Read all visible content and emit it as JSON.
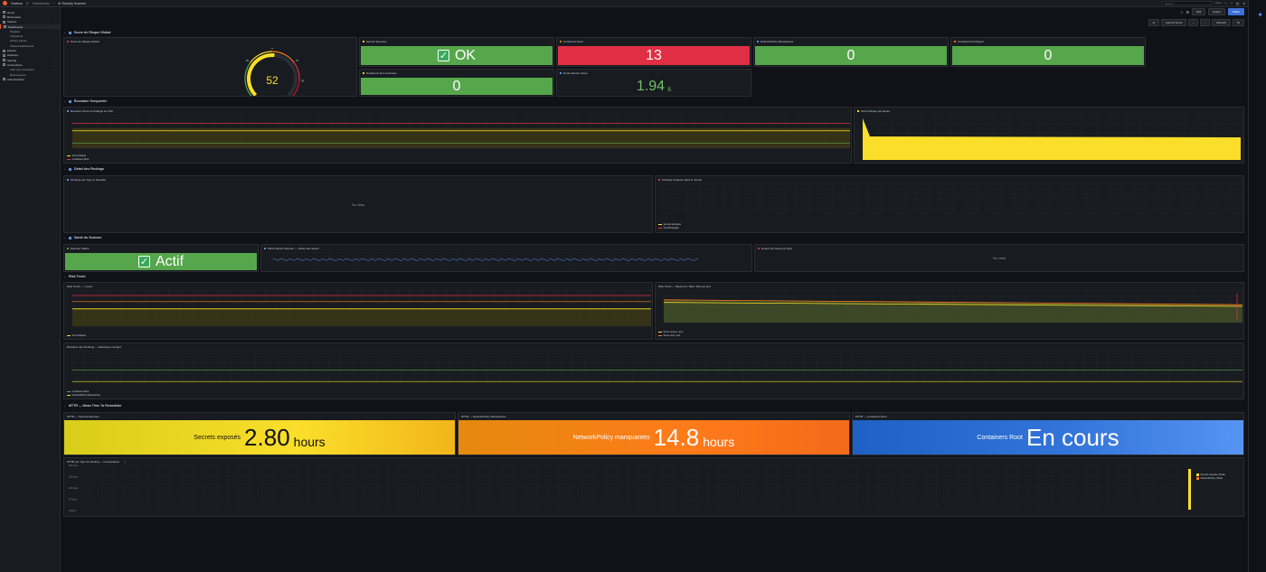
{
  "app": {
    "brand": "Grafana"
  },
  "breadcrumb": [
    "Dashboards",
    "AI Security Scanner"
  ],
  "search": {
    "placeholder": "Search..."
  },
  "topbar": {
    "shortcut": "ctrl+k"
  },
  "toolbar": {
    "edit": "Edit",
    "export": "Export",
    "share": "Share",
    "time_range": "Last 24 hours",
    "refresh": "Refresh",
    "interval": "5s"
  },
  "sidebar": {
    "items": [
      {
        "label": "Home"
      },
      {
        "label": "Bookmarks"
      },
      {
        "label": "Starred"
      },
      {
        "label": "Dashboards"
      },
      {
        "label": "Playlists"
      },
      {
        "label": "Snapshots"
      },
      {
        "label": "Library panels"
      },
      {
        "label": "Shared dashboards"
      },
      {
        "label": "Explore"
      },
      {
        "label": "Drilldown"
      },
      {
        "label": "Alerting"
      },
      {
        "label": "Connections"
      },
      {
        "label": "Add new connection"
      },
      {
        "label": "Data sources"
      },
      {
        "label": "Administration"
      }
    ]
  },
  "sections": {
    "score": "Score de Risque Global",
    "evolution": "Évolution Temporelle",
    "findings": "Détail des Findings",
    "scanner": "Santé du Scanner",
    "risk": "Risk Trend",
    "mttr": "MTTR — Mean Time To Remediate"
  },
  "panels": {
    "gauge": {
      "title": "Score de Risque Global",
      "value": "52",
      "ticks": [
        "0",
        "30",
        "50",
        "70",
        "85",
        "100"
      ]
    },
    "secrets": {
      "title": "Secrets Exposés",
      "value": "OK"
    },
    "containers_root": {
      "title": "Containers Root",
      "value": "13"
    },
    "netpol": {
      "title": "NetworkPolicy Manquantes",
      "value": "0"
    },
    "privileged": {
      "title": "Containers Privileged",
      "value": "0"
    },
    "nodeports": {
      "title": "NodePorts Non Autorisés",
      "value": "0"
    },
    "duration": {
      "title": "Durée Dernier Scan",
      "value": "1.94",
      "unit": "s"
    },
    "evolution_chart": {
      "title": "Évolution Score & Findings sur 24h",
      "legend": [
        "Score Risque",
        "Containers Root"
      ]
    },
    "risk_per_hour": {
      "title": "Score Risque par Heure"
    },
    "findings_type": {
      "title": "Findings par Type et Sévérité",
      "nodata": "No data"
    },
    "critical_time": {
      "title": "Findings Critiques dans le Temps",
      "legend": [
        "Secrets Exposés",
        "SCCPrivileged"
      ]
    },
    "scanner_status": {
      "title": "Scanner Status",
      "value": "Actif"
    },
    "scanner_perf": {
      "title": "Performance Scanner — Durée des Scans"
    },
    "scan_errors": {
      "title": "Erreurs de Scan par Type",
      "nodata": "No data"
    },
    "risk_7d": {
      "title": "Risk Trend — 7 jours",
      "legend": [
        "Score Risque"
      ]
    },
    "risk_daily": {
      "title": "Risk Trend — Moyenne / Max / Min par jour",
      "legend": [
        "Score moyen / jour",
        "Score max / jour"
      ]
    },
    "findings_history": {
      "title": "Évolution des Findings — Historique complet",
      "legend": [
        "Containers Root",
        "NetworkPolicy Manquantes"
      ]
    },
    "mttr_secrets": {
      "title": "MTTR — Secrets Exposés",
      "label": "Secrets exposés",
      "value": "2.80",
      "unit": "hours"
    },
    "mttr_netpol": {
      "title": "MTTR — NetworkPolicy Manquantes",
      "label": "NetworkPolicy manquantes",
      "value": "14.8",
      "unit": "hours"
    },
    "mttr_root": {
      "title": "MTTR — Containers Root",
      "label": "Containers Root",
      "value": "En cours"
    },
    "mttr_compare": {
      "title": "MTTR par Type de Finding — Comparaison",
      "yticks": [
        "200 hours",
        "150 hours",
        "100 hours",
        "50 hours",
        "0 hours"
      ],
      "legend": [
        "Secrets exposés (Total)",
        "NetworkPolicy (Total)"
      ]
    }
  },
  "colors": {
    "green": "#56a64b",
    "red": "#e02f44",
    "yellow": "#fade2a",
    "orange": "#ff7a1a",
    "blue": "#3274d9"
  }
}
